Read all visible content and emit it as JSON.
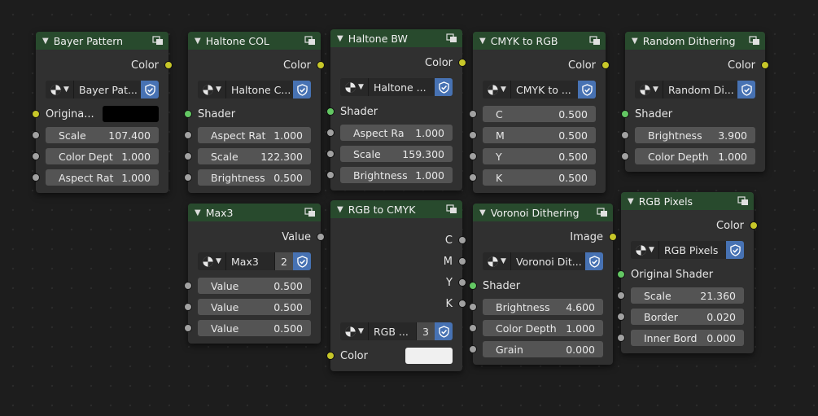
{
  "colors": {
    "header": "#284a2d",
    "node_bg": "#303030",
    "slot_bg": "#545454",
    "shield": "#4772b3",
    "socket_color": "#c7c729",
    "socket_value": "#a1a1a1",
    "socket_shader": "#63c763",
    "swatch_black": "#000000",
    "swatch_white": "#f0f0f0"
  },
  "nodes": {
    "bayer": {
      "title": "Bayer Pattern",
      "output": "Color",
      "selector": "Bayer Pat...",
      "input_label": "Origina...",
      "fields": [
        {
          "label": "Scale",
          "value": "107.400"
        },
        {
          "label": "Color Dept",
          "value": "1.000"
        },
        {
          "label": "Aspect Rat",
          "value": "1.000"
        }
      ]
    },
    "halftone_col": {
      "title": "Haltone COL",
      "output": "Color",
      "selector": "Haltone C...",
      "shader": "Shader",
      "fields": [
        {
          "label": "Aspect Rat",
          "value": "1.000"
        },
        {
          "label": "Scale",
          "value": "122.300"
        },
        {
          "label": "Brightness",
          "value": "0.500"
        }
      ]
    },
    "halftone_bw": {
      "title": "Haltone BW",
      "output": "Color",
      "selector": "Haltone ...",
      "shader": "Shader",
      "fields": [
        {
          "label": "Aspect Ra",
          "value": "1.000"
        },
        {
          "label": "Scale",
          "value": "159.300"
        },
        {
          "label": "Brightness",
          "value": "1.000"
        }
      ]
    },
    "cmyk_to_rgb": {
      "title": "CMYK to RGB",
      "output": "Color",
      "selector": "CMYK to ...",
      "fields": [
        {
          "label": "C",
          "value": "0.500"
        },
        {
          "label": "M",
          "value": "0.500"
        },
        {
          "label": "Y",
          "value": "0.500"
        },
        {
          "label": "K",
          "value": "0.500"
        }
      ]
    },
    "random_dither": {
      "title": "Random Dithering",
      "output": "Color",
      "selector": "Random Di...",
      "shader": "Shader",
      "fields": [
        {
          "label": "Brightness",
          "value": "3.900"
        },
        {
          "label": "Color Depth",
          "value": "1.000"
        }
      ]
    },
    "max3": {
      "title": "Max3",
      "output": "Value",
      "selector": "Max3",
      "users": "2",
      "fields": [
        {
          "label": "Value",
          "value": "0.500"
        },
        {
          "label": "Value",
          "value": "0.500"
        },
        {
          "label": "Value",
          "value": "0.500"
        }
      ]
    },
    "rgb_to_cmyk": {
      "title": "RGB to CMYK",
      "outputs": [
        "C",
        "M",
        "Y",
        "K"
      ],
      "selector": "RGB ...",
      "users": "3",
      "input_label": "Color"
    },
    "voronoi": {
      "title": "Voronoi Dithering",
      "output": "Image",
      "selector": "Voronoi Dit...",
      "shader": "Shader",
      "fields": [
        {
          "label": "Brightness",
          "value": "4.600"
        },
        {
          "label": "Color Depth",
          "value": "1.000"
        },
        {
          "label": "Grain",
          "value": "0.000"
        }
      ]
    },
    "rgb_pixels": {
      "title": "RGB Pixels",
      "output": "Color",
      "selector": "RGB Pixels",
      "shader": "Original Shader",
      "fields": [
        {
          "label": "Scale",
          "value": "21.360"
        },
        {
          "label": "Border",
          "value": "0.020"
        },
        {
          "label": "Inner Bord",
          "value": "0.000"
        }
      ]
    }
  }
}
